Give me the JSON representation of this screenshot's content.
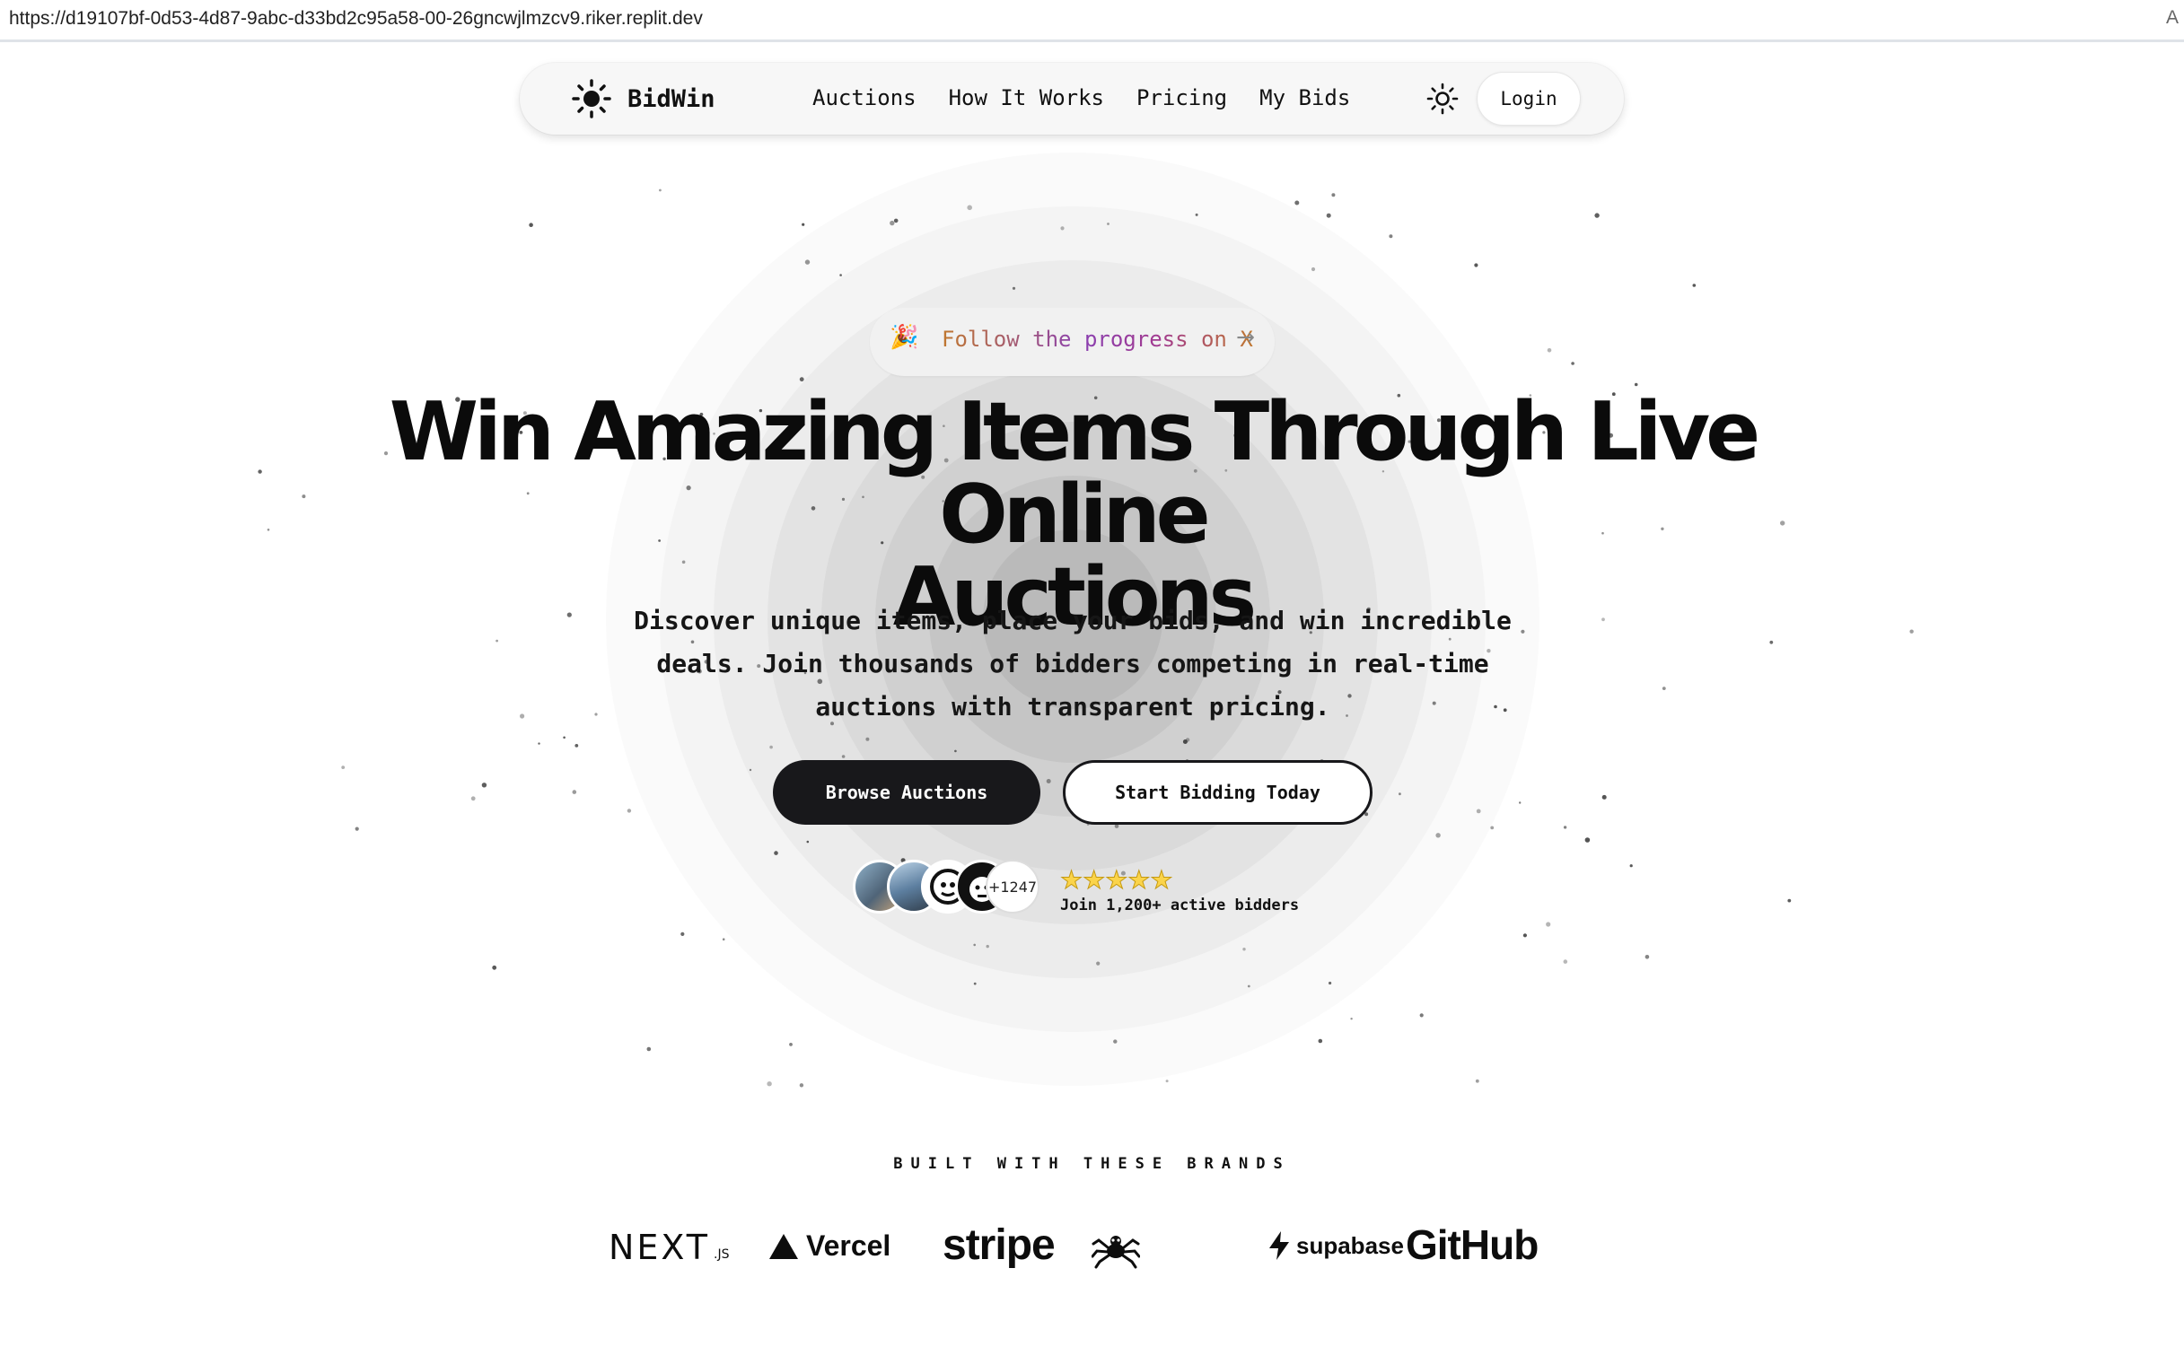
{
  "browser": {
    "url": "https://d19107bf-0d53-4d87-9abc-d33bd2c95a58-00-26gncwjlmzcv9.riker.replit.dev",
    "reader_icon": "A"
  },
  "nav": {
    "brand": "BidWin",
    "links": [
      "Auctions",
      "How It Works",
      "Pricing",
      "My Bids"
    ],
    "login": "Login"
  },
  "hero": {
    "badge_emoji": "🎉",
    "badge_text": "Follow the progress on X",
    "badge_arrow": "→",
    "headline_line1": "Win Amazing Items Through Live Online",
    "headline_line2": "Auctions",
    "subtext": "Discover unique items, place your bids, and win incredible deals. Join thousands of bidders competing in real-time auctions with transparent pricing.",
    "primary_cta": "Browse Auctions",
    "secondary_cta": "Start Bidding Today",
    "avatar_count": "+1247",
    "rating_stars": "★★★★★",
    "social_proof": "Join 1,200+ active bidders"
  },
  "brands": {
    "title": "BUILT WITH THESE BRANDS",
    "next_main": "NEXT",
    "next_suffix": ".JS",
    "vercel": "Vercel",
    "stripe": "stripe",
    "supabase": "supabase",
    "github": "GitHub"
  },
  "colors": {
    "primary_button": "#18181b",
    "star": "#fbd44a",
    "pill_gradient_start": "#c0772e",
    "pill_gradient_mid": "#8a3fb0"
  },
  "icons": [
    "sun-icon",
    "theme-toggle-icon",
    "party-popper-icon",
    "arrow-right-icon",
    "star-icon",
    "vercel-triangle-icon",
    "supabase-bolt-icon",
    "spider-icon"
  ]
}
